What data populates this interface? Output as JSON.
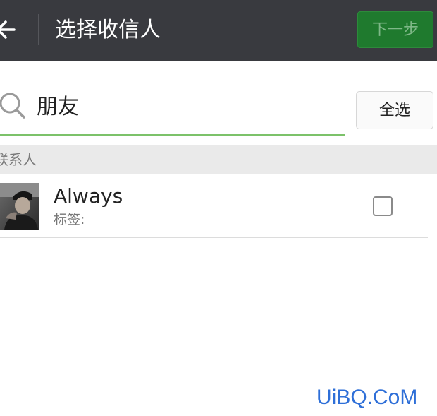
{
  "header": {
    "title": "选择收信人",
    "next_label": "下一步"
  },
  "search": {
    "value": "朋友"
  },
  "select_all_label": "全选",
  "section": {
    "label": "联系人"
  },
  "contacts": [
    {
      "name": "Always",
      "tag_label": "标签:",
      "checked": false
    }
  ],
  "watermark": "UiBQ.CoM",
  "colors": {
    "topbar": "#393a3f",
    "next_button": "#1f7a2e",
    "search_underline": "#7cc26a",
    "watermark": "#2e6fd8"
  }
}
